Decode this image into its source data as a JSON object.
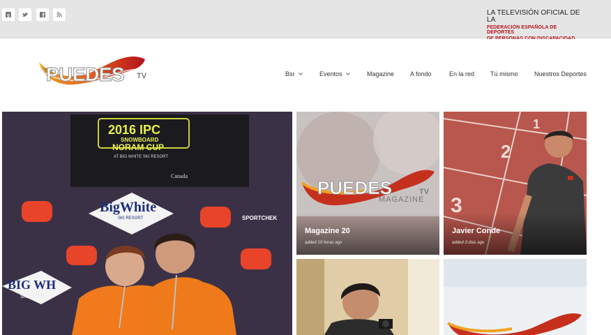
{
  "topbar": {
    "social": [
      {
        "icon": "google-plus-icon"
      },
      {
        "icon": "twitter-icon"
      },
      {
        "icon": "facebook-icon"
      },
      {
        "icon": "rss-icon"
      }
    ],
    "federation": {
      "line1": "LA TELEVISIÓN OFICIAL DE LA",
      "line2": "FEDERACIÓN ESPAÑOLA DE DEPORTES",
      "line3": "DE PERSONAS CON DISCAPACIDAD FÍSICA"
    }
  },
  "logo": {
    "tu": "TÚ",
    "main": "PUEDES",
    "tv": "TV"
  },
  "nav": {
    "items": [
      {
        "label": "Bsr",
        "has_dropdown": true
      },
      {
        "label": "Eventos",
        "has_dropdown": true
      },
      {
        "label": "Magazine",
        "has_dropdown": false
      },
      {
        "label": "A fondo",
        "has_dropdown": false
      },
      {
        "label": "En la red",
        "has_dropdown": false
      },
      {
        "label": "Tú mismo",
        "has_dropdown": false
      },
      {
        "label": "Nuestros Deportes",
        "has_dropdown": false
      }
    ]
  },
  "featured": {
    "banner_line1": "2016 IPC",
    "banner_line2": "SNOWBOARD",
    "banner_line3": "NORAM CUP",
    "banner_line4": "AT BIG WHITE SKI RESORT",
    "sponsor1": "BigWhite",
    "sponsor1_sub": "SKI RESORT",
    "sponsor2": "SPORTCHEK",
    "sponsor3": "BIG WH",
    "sponsor3_sub": "SKI",
    "canada": "Canada"
  },
  "tiles": [
    {
      "title": "Magazine 20",
      "ago": "added 19 horas ago",
      "logo_sub": "MAGAZINE"
    },
    {
      "title": "Javier Conde",
      "ago": "added 3 días ago",
      "track_nums": [
        "1",
        "2",
        "3"
      ]
    },
    {
      "title": "",
      "ago": ""
    },
    {
      "title": "",
      "ago": ""
    }
  ],
  "colors": {
    "accent_red": "#b5121b",
    "logo_orange": "#e8891a",
    "topbar_bg": "#e6e5e6"
  }
}
